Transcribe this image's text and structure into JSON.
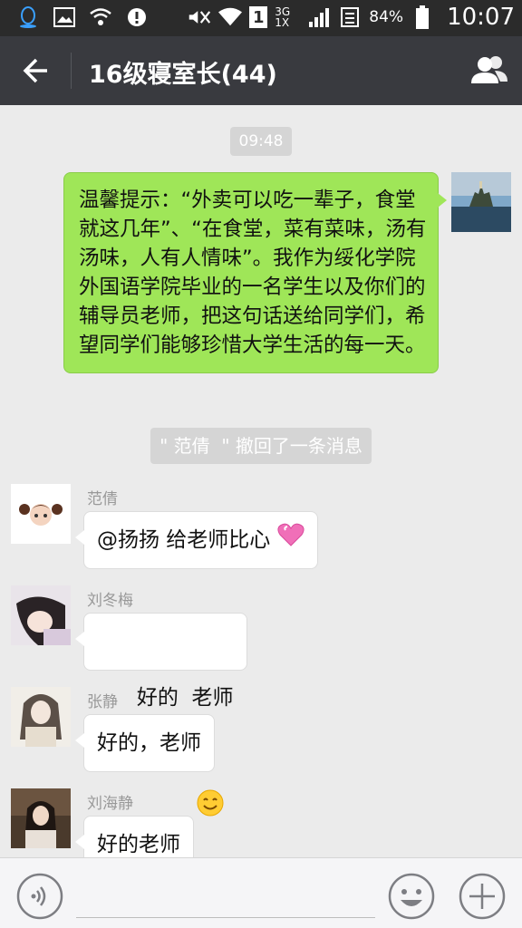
{
  "status_bar": {
    "battery": "84%",
    "time": "10:07",
    "sim": "1",
    "network": "3G 1X"
  },
  "header": {
    "title": "16级寝室长(44)",
    "background": "#393a3f"
  },
  "chat": {
    "timestamp": "09:48",
    "outgoing_message": "温馨提示：“外卖可以吃一辈子，食堂就这几年”、“在食堂，菜有菜味，汤有汤味，人有人情味”。我作为绥化学院外国语学院毕业的一名学生以及你们的辅导员老师，把这句话送给同学们，希望同学们能够珍惜大学生活的每一天。",
    "recall_notice": "\" 范倩  \" 撤回了一条消息",
    "messages": [
      {
        "sender": "范倩",
        "text": "@扬扬 给老师比心",
        "emoji": "pink-heart-icon"
      },
      {
        "sender": "刘冬梅",
        "text": "好的  老师",
        "emoji": "smile-face-icon"
      },
      {
        "sender": "张静",
        "text": "好的，老师",
        "emoji": ""
      },
      {
        "sender": "刘海静",
        "text": "好的老师",
        "emoji": ""
      }
    ]
  },
  "input_bar": {
    "placeholder": ""
  },
  "colors": {
    "outgoing_bubble": "#9fe658",
    "incoming_bubble": "#ffffff",
    "chat_background": "#ebebeb"
  }
}
